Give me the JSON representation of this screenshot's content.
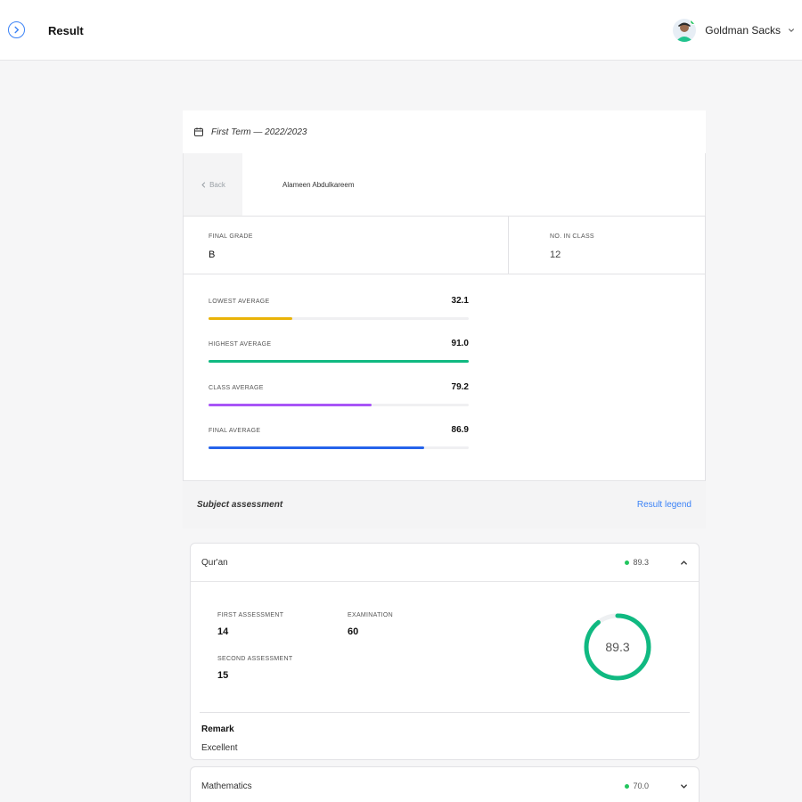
{
  "header": {
    "title": "Result",
    "user_name": "Goldman Sacks"
  },
  "term": {
    "label": "First Term — 2022/2023"
  },
  "student": {
    "back_label": "Back",
    "name": "Alameen Abdulkareem"
  },
  "stats": {
    "final_grade_label": "FINAL GRADE",
    "final_grade": "B",
    "no_in_class_label": "NO. IN CLASS",
    "no_in_class": "12"
  },
  "averages": [
    {
      "label": "LOWEST AVERAGE",
      "value": "32.1",
      "percent": 32.1,
      "color": "#eab308"
    },
    {
      "label": "HIGHEST AVERAGE",
      "value": "91.0",
      "percent": 100,
      "color": "#10b981"
    },
    {
      "label": "CLASS AVERAGE",
      "value": "79.2",
      "percent": 62.5,
      "color": "#a855f7"
    },
    {
      "label": "FINAL AVERAGE",
      "value": "86.9",
      "percent": 83,
      "color": "#2563eb"
    }
  ],
  "assessment": {
    "title": "Subject assessment",
    "legend_link": "Result legend"
  },
  "subjects": [
    {
      "name": "Qur'an",
      "score": "89.3",
      "score_percent": 89.3,
      "first_assessment_label": "FIRST ASSESSMENT",
      "first_assessment": "14",
      "second_assessment_label": "SECOND ASSESSMENT",
      "second_assessment": "15",
      "examination_label": "EXAMINATION",
      "examination": "60",
      "remark_label": "Remark",
      "remark": "Excellent"
    },
    {
      "name": "Mathematics",
      "score": "70.0"
    }
  ],
  "colors": {
    "accent": "#3b82f6",
    "success": "#22c55e",
    "ring": "#10b981"
  }
}
